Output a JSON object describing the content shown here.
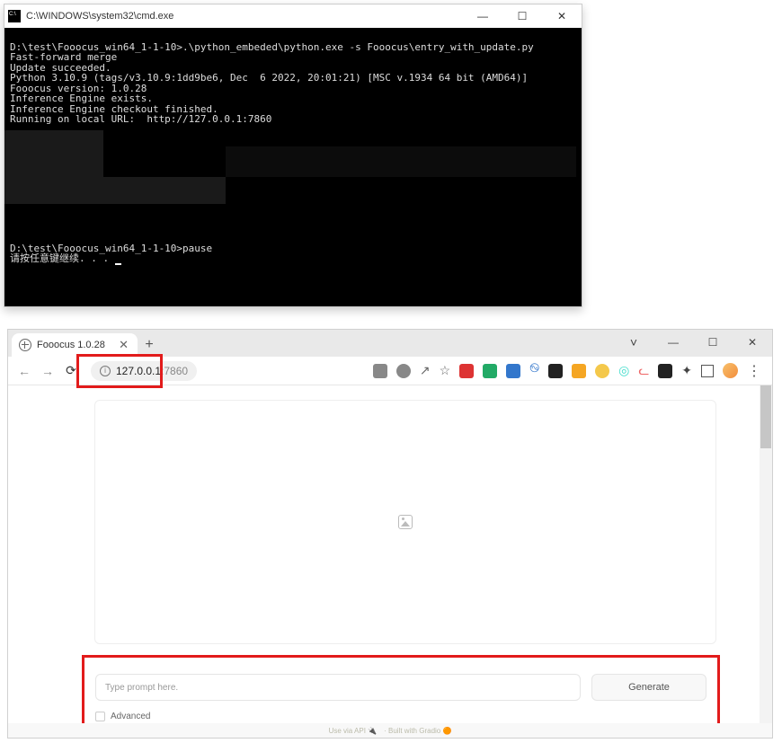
{
  "cmd": {
    "title": "C:\\WINDOWS\\system32\\cmd.exe",
    "lines": {
      "l1": "D:\\test\\Fooocus_win64_1-1-10>.\\python_embeded\\python.exe -s Fooocus\\entry_with_update.py",
      "l2": "Fast-forward merge",
      "l3": "Update succeeded.",
      "l4": "Python 3.10.9 (tags/v3.10.9:1dd9be6, Dec  6 2022, 20:01:21) [MSC v.1934 64 bit (AMD64)]",
      "l5": "Fooocus version: 1.0.28",
      "l6": "Inference Engine exists.",
      "l7": "Inference Engine checkout finished.",
      "l8": "Running on local URL:  http://127.0.0.1:7860",
      "l9": "D:\\test\\Fooocus_win64_1-1-10>pause",
      "l10": "请按任意键继续. . . "
    }
  },
  "browser": {
    "tab_title": "Fooocus 1.0.28",
    "url_host": "127.0.0.1",
    "url_port": ":7860",
    "prompt_placeholder": "Type prompt here.",
    "generate_label": "Generate",
    "advanced_label": "Advanced",
    "footer_api": "Use via API 🔌",
    "footer_gradio": "· Built with Gradio 🟠"
  },
  "winbtns": {
    "min": "—",
    "max": "☐",
    "close": "✕",
    "chevron": "˅",
    "plus": "+"
  }
}
